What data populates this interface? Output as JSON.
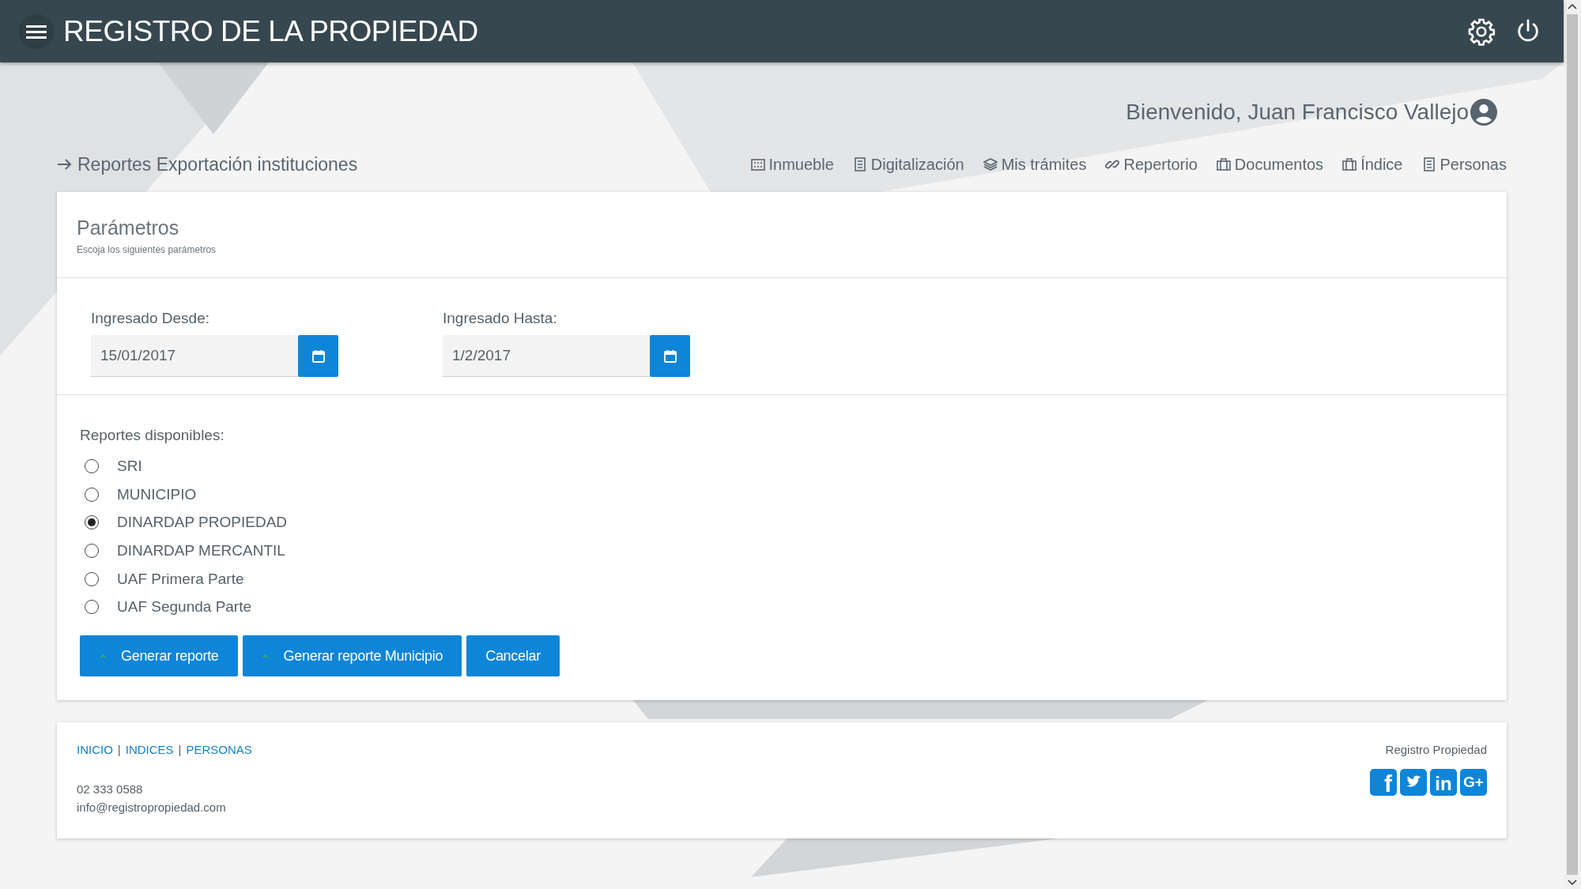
{
  "header": {
    "title": "REGISTRO DE LA PROPIEDAD"
  },
  "welcome": "Bienvenido, Juan Francisco Vallejo",
  "breadcrumb": "Reportes Exportación instituciones",
  "nav": [
    {
      "label": "Inmueble",
      "kind": "building"
    },
    {
      "label": "Digitalización",
      "kind": "doc"
    },
    {
      "label": "Mis trámites",
      "kind": "layers"
    },
    {
      "label": "Repertorio",
      "kind": "link"
    },
    {
      "label": "Documentos",
      "kind": "briefcase"
    },
    {
      "label": "Índice",
      "kind": "briefcase"
    },
    {
      "label": "Personas",
      "kind": "doc"
    }
  ],
  "parameters": {
    "title": "Parámetros",
    "subtitle": "Escoja los siguientes parámetros",
    "fields": [
      {
        "label": "Ingresado Desde:",
        "value": "15/01/2017"
      },
      {
        "label": "Ingresado Hasta:",
        "value": "1/2/2017"
      }
    ],
    "reports_label": "Reportes disponibles:",
    "reports": [
      {
        "label": "SRI",
        "selected": false
      },
      {
        "label": "MUNICIPIO",
        "selected": false
      },
      {
        "label": "DINARDAP PROPIEDAD",
        "selected": true
      },
      {
        "label": "DINARDAP MERCANTIL",
        "selected": false
      },
      {
        "label": "UAF Primera Parte",
        "selected": false
      },
      {
        "label": "UAF Segunda Parte",
        "selected": false
      }
    ],
    "buttons": [
      {
        "label": "Generar reporte",
        "kind": "caret"
      },
      {
        "label": "Generar reporte Municipio",
        "kind": "caret"
      },
      {
        "label": "Cancelar",
        "kind": "plain"
      }
    ]
  },
  "footer": {
    "links": [
      "INICIO",
      "INDICES",
      "PERSONAS"
    ],
    "separator": "|",
    "phone": "02 333 0588",
    "email": "info@registropropiedad.com",
    "brand": "Registro Propiedad",
    "social": [
      {
        "kind": "facebook",
        "glyph": "f"
      },
      {
        "kind": "twitter"
      },
      {
        "kind": "linkedin",
        "glyph": "in"
      },
      {
        "kind": "google",
        "glyph": "G+"
      }
    ]
  }
}
